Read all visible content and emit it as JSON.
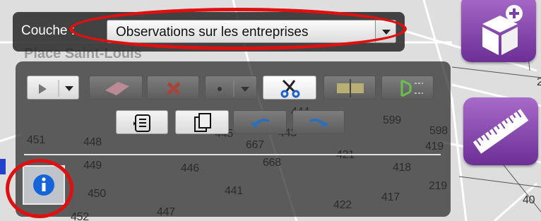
{
  "layer_selector": {
    "label": "Couche :",
    "selected_layer": "Observations sur les entreprises"
  },
  "map": {
    "street_name": "Place Saint-Louis",
    "parcel_numbers": [
      "451",
      "448",
      "449",
      "446",
      "450",
      "441",
      "447",
      "452",
      "445",
      "443",
      "444",
      "667",
      "668",
      "421",
      "599",
      "598",
      "419",
      "418",
      "219",
      "417",
      "422",
      "2",
      "40"
    ]
  },
  "edit_toolbar": {
    "row1": [
      "select-tool",
      "eraser-tool",
      "delete-tool",
      "point-tool",
      "cut-tool",
      "split-tool",
      "reshape-tool"
    ],
    "row2": [
      "attributes-tool",
      "copy-tool",
      "undo-tool",
      "redo-tool"
    ],
    "active_tool": "cut-tool"
  },
  "icons": {
    "add_3d": "cube-plus-icon",
    "measure": "ruler-icon",
    "info": "info-icon"
  },
  "colors": {
    "accent_purple": "#7b3fa6",
    "annotation_red": "#e01010",
    "info_blue": "#1565d8"
  }
}
